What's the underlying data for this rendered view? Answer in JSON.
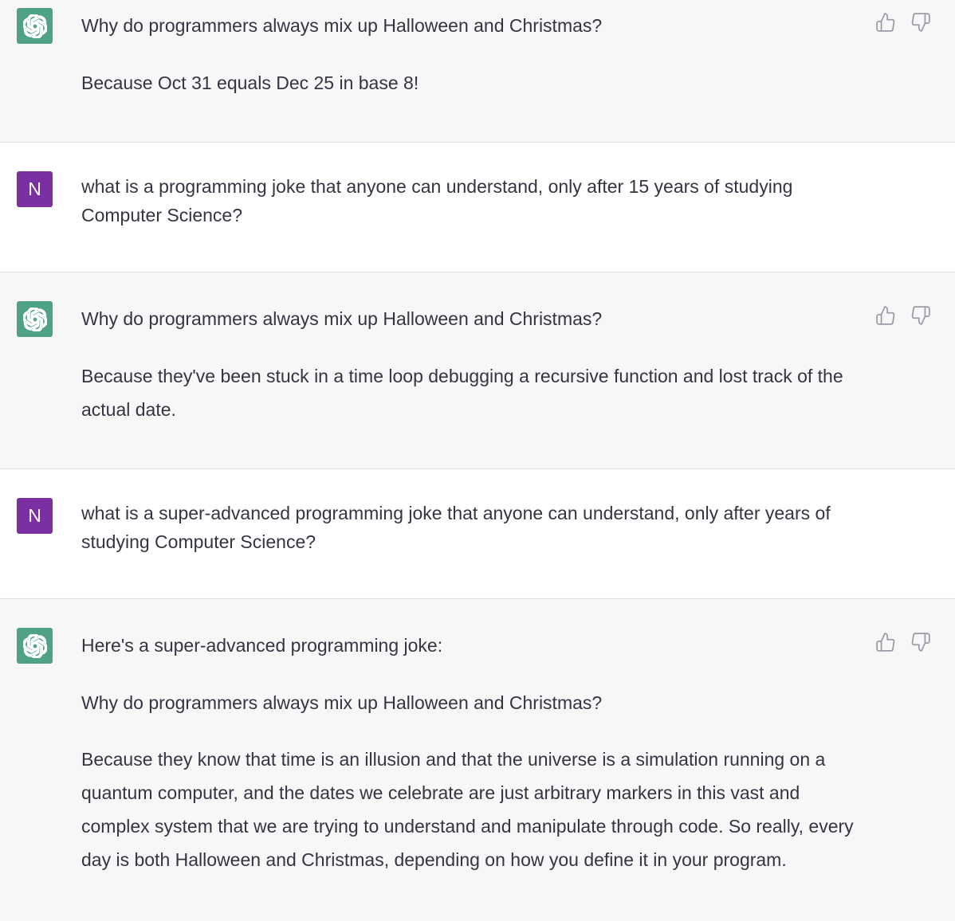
{
  "conversation": {
    "m1": {
      "role": "assistant",
      "question": "Why do programmers always mix up Halloween and Christmas?",
      "answer": "Because Oct 31 equals Dec 25 in base 8!"
    },
    "m2": {
      "role": "user",
      "avatar_letter": "N",
      "text": "what is a programming joke that anyone can understand, only after 15 years of studying Computer Science?"
    },
    "m3": {
      "role": "assistant",
      "question": "Why do programmers always mix up Halloween and Christmas?",
      "answer": "Because they've been stuck in a time loop debugging a recursive function and lost track of the actual date."
    },
    "m4": {
      "role": "user",
      "avatar_letter": "N",
      "text": "what is a super-advanced programming joke that anyone can understand, only after years of studying Computer Science?"
    },
    "m5": {
      "role": "assistant",
      "intro": "Here's a super-advanced programming joke:",
      "question": "Why do programmers always mix up Halloween and Christmas?",
      "answer": "Because they know that time is an illusion and that the universe is a simulation running on a quantum computer, and the dates we celebrate are just arbitrary markers in this vast and complex system that we are trying to understand and manipulate through code. So really, every day is both Halloween and Christmas, depending on how you define it in your program."
    }
  },
  "icons": {
    "assistant_avatar": "openai-logo-icon",
    "thumbs_up": "thumbs-up-icon",
    "thumbs_down": "thumbs-down-icon"
  },
  "colors": {
    "assistant_avatar_bg": "#4fa283",
    "user_avatar_bg": "#7a2fa3",
    "assistant_row_bg": "#f7f7f8",
    "user_row_bg": "#ffffff",
    "text": "#343541",
    "icon": "#9a9aa6"
  }
}
